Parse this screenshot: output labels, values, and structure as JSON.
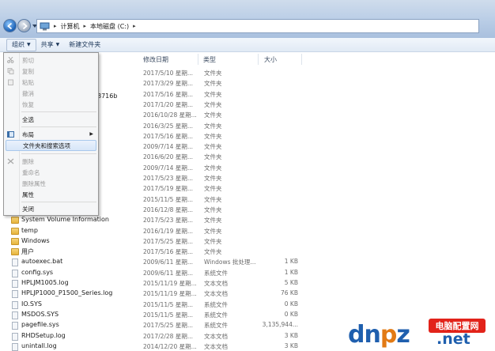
{
  "address": {
    "breadcrumbs": [
      "计算机",
      "本地磁盘 (C:)"
    ]
  },
  "toolbar": {
    "organize_label": "组织",
    "share_label": "共享",
    "new_folder_label": "新建文件夹"
  },
  "columns": {
    "date": "修改日期",
    "type": "类型",
    "size": "大小"
  },
  "partial_name_fragment": "8716b",
  "rows": [
    {
      "name": "",
      "date": "2017/5/10 星期...",
      "type": "文件夹",
      "size": "",
      "icon": "folder"
    },
    {
      "name": "",
      "date": "2017/3/29 星期...",
      "type": "文件夹",
      "size": "",
      "icon": "folder"
    },
    {
      "name": "",
      "date": "2017/5/16 星期...",
      "type": "文件夹",
      "size": "",
      "icon": "folder"
    },
    {
      "name": "",
      "date": "2017/1/20 星期...",
      "type": "文件夹",
      "size": "",
      "icon": "folder"
    },
    {
      "name": "",
      "date": "2016/10/28 星期...",
      "type": "文件夹",
      "size": "",
      "icon": "folder"
    },
    {
      "name": "",
      "date": "2016/3/25 星期...",
      "type": "文件夹",
      "size": "",
      "icon": "folder"
    },
    {
      "name": "",
      "date": "2017/5/16 星期...",
      "type": "文件夹",
      "size": "",
      "icon": "folder"
    },
    {
      "name": "",
      "date": "2009/7/14 星期...",
      "type": "文件夹",
      "size": "",
      "icon": "folder"
    },
    {
      "name": "",
      "date": "2016/6/20 星期...",
      "type": "文件夹",
      "size": "",
      "icon": "folder"
    },
    {
      "name": "",
      "date": "2009/7/14 星期...",
      "type": "文件夹",
      "size": "",
      "icon": "folder"
    },
    {
      "name": "",
      "date": "2017/5/23 星期...",
      "type": "文件夹",
      "size": "",
      "icon": "folder"
    },
    {
      "name": "",
      "date": "2017/5/19 星期...",
      "type": "文件夹",
      "size": "",
      "icon": "folder"
    },
    {
      "name": "",
      "date": "2015/11/5 星期...",
      "type": "文件夹",
      "size": "",
      "icon": "folder"
    },
    {
      "name": "",
      "date": "2016/12/8 星期...",
      "type": "文件夹",
      "size": "",
      "icon": "folder"
    },
    {
      "name": "System Volume Information",
      "date": "2017/5/23 星期...",
      "type": "文件夹",
      "size": "",
      "icon": "folder"
    },
    {
      "name": "temp",
      "date": "2016/1/19 星期...",
      "type": "文件夹",
      "size": "",
      "icon": "folder"
    },
    {
      "name": "Windows",
      "date": "2017/5/25 星期...",
      "type": "文件夹",
      "size": "",
      "icon": "folder"
    },
    {
      "name": "用户",
      "date": "2017/5/16 星期...",
      "type": "文件夹",
      "size": "",
      "icon": "folder"
    },
    {
      "name": "autoexec.bat",
      "date": "2009/6/11 星期...",
      "type": "Windows 批处理...",
      "size": "1 KB",
      "icon": "doc"
    },
    {
      "name": "config.sys",
      "date": "2009/6/11 星期...",
      "type": "系统文件",
      "size": "1 KB",
      "icon": "doc"
    },
    {
      "name": "HPLJM1005.log",
      "date": "2015/11/19 星期...",
      "type": "文本文档",
      "size": "5 KB",
      "icon": "doc"
    },
    {
      "name": "HPLJP1000_P1500_Series.log",
      "date": "2015/11/19 星期...",
      "type": "文本文档",
      "size": "76 KB",
      "icon": "doc"
    },
    {
      "name": "IO.SYS",
      "date": "2015/11/5 星期...",
      "type": "系统文件",
      "size": "0 KB",
      "icon": "doc"
    },
    {
      "name": "MSDOS.SYS",
      "date": "2015/11/5 星期...",
      "type": "系统文件",
      "size": "0 KB",
      "icon": "doc"
    },
    {
      "name": "pagefile.sys",
      "date": "2017/5/25 星期...",
      "type": "系统文件",
      "size": "3,135,944...",
      "icon": "doc"
    },
    {
      "name": "RHDSetup.log",
      "date": "2017/2/28 星期...",
      "type": "文本文档",
      "size": "3 KB",
      "icon": "doc"
    },
    {
      "name": "unintall.log",
      "date": "2014/12/20 星期...",
      "type": "文本文档",
      "size": "3 KB",
      "icon": "doc"
    }
  ],
  "menu": {
    "cut": "剪切",
    "copy": "复制",
    "paste": "粘贴",
    "undo": "撤消",
    "redo": "恢复",
    "select_all": "全选",
    "layout": "布局",
    "folder_options": "文件夹和搜索选项",
    "delete": "删除",
    "rename": "重命名",
    "remove_props": "删除属性",
    "properties": "属性",
    "close": "关闭"
  },
  "watermark": {
    "logo_letters": "dnpz.net",
    "badge": "电脑配置网"
  }
}
